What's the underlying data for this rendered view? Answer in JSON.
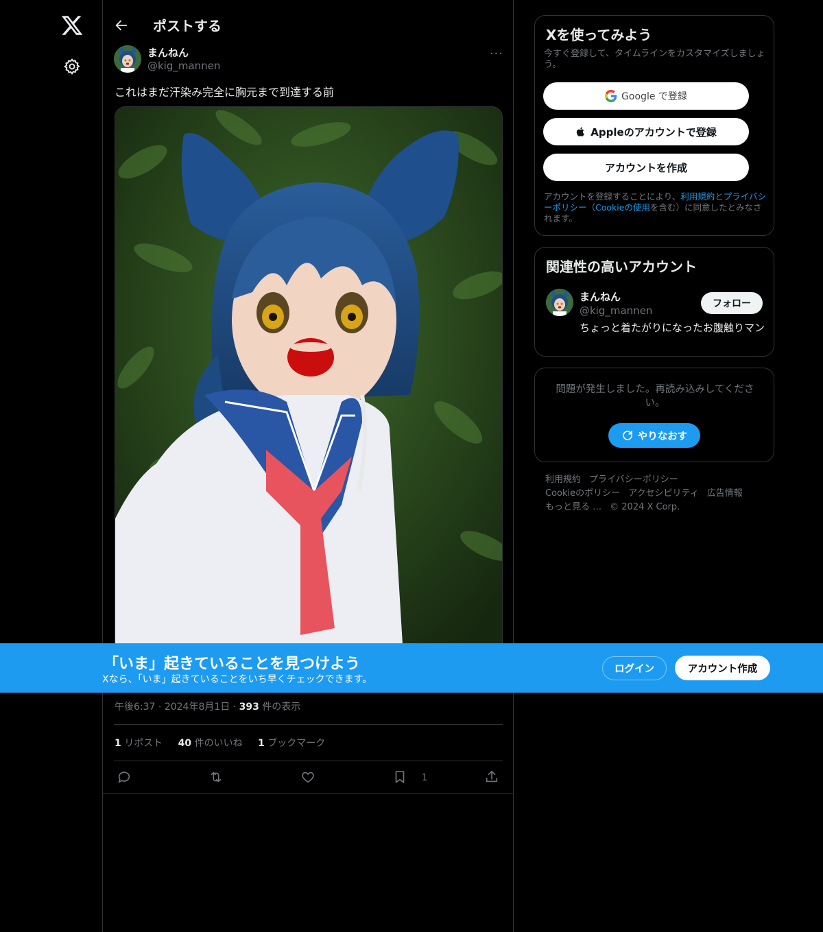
{
  "nav": {
    "logo": "x-logo-icon",
    "settings": "gear-icon"
  },
  "header": {
    "title": "ポストする",
    "back_icon": "arrow-left-icon"
  },
  "post": {
    "author_name": "まんねん",
    "author_handle": "@kig_mannen",
    "more_icon": "···",
    "text": "これはまだ汗染み完全に胸元まで到達する前",
    "time": "午後6:37",
    "dot1": "·",
    "date": "2024年8月1日",
    "dot2": "·",
    "views": "393",
    "views_label": "件の表示",
    "reposts": "1",
    "reposts_label": "リポスト",
    "likes": "40",
    "likes_label": "件のいいね",
    "bookmarks": "1",
    "bookmarks_label": "ブックマーク",
    "action_bookmark_count": "1"
  },
  "signup_card": {
    "title": "Xを使ってみよう",
    "subtitle": "今すぐ登録して、タイムラインをカスタマイズしましょう。",
    "google_label": "Google で登録",
    "apple_label": "Appleのアカウントで登録",
    "create_label": "アカウントを作成",
    "legal_prefix": "アカウントを登録することにより、",
    "legal_terms": "利用規約",
    "legal_and": "と",
    "legal_privacy": "プライバシーポリシー",
    "legal_open": "（",
    "legal_cookie": "Cookieの使用",
    "legal_suffix": "を含む）に同意したとみなされます。"
  },
  "related_card": {
    "title": "関連性の高いアカウント",
    "name": "まんねん",
    "handle": "@kig_mannen",
    "bio": "ちょっと着たがりになったお腹触りマン",
    "follow_label": "フォロー"
  },
  "error_card": {
    "message": "問題が発生しました。再読み込みしてください。",
    "retry_label": "やりなおす"
  },
  "footer": {
    "links": [
      "利用規約",
      "プライバシーポリシー",
      "Cookieのポリシー",
      "アクセシビリティ",
      "広告情報",
      "もっと見る …",
      "© 2024 X Corp."
    ]
  },
  "banner": {
    "title": "「いま」起きていることを見つけよう",
    "subtitle": "Xなら、「いま」起きていることをいち早くチェックできます。",
    "login_label": "ログイン",
    "signup_label": "アカウント作成",
    "background": "#1d9bf0"
  },
  "colors": {
    "accent": "#1d9bf0",
    "text_primary": "#e7e9ea",
    "text_secondary": "#71767b",
    "border": "#2f3336"
  }
}
